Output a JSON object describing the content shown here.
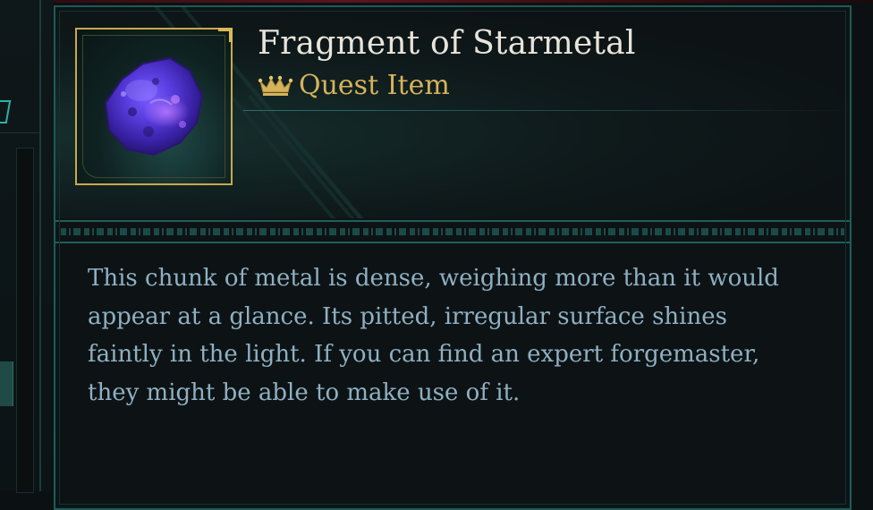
{
  "item": {
    "name": "Fragment of Starmetal",
    "rarity_label": "Quest Item",
    "rarity_icon": "crown-icon",
    "image_icon": "starmetal-fragment-icon",
    "description": "This chunk of metal is dense, weighing more than it would appear at a glance. Its pitted, irregular surface shines faintly in the light. If you can find an expert forgemaster, they might be able to make use of it."
  },
  "colors": {
    "name_text": "#e8e4da",
    "rarity_gold": "#d6b35a",
    "description_text": "#8fb0c2",
    "frame_teal": "#1f5a55",
    "icon_border_gold": "#c9a94a"
  }
}
